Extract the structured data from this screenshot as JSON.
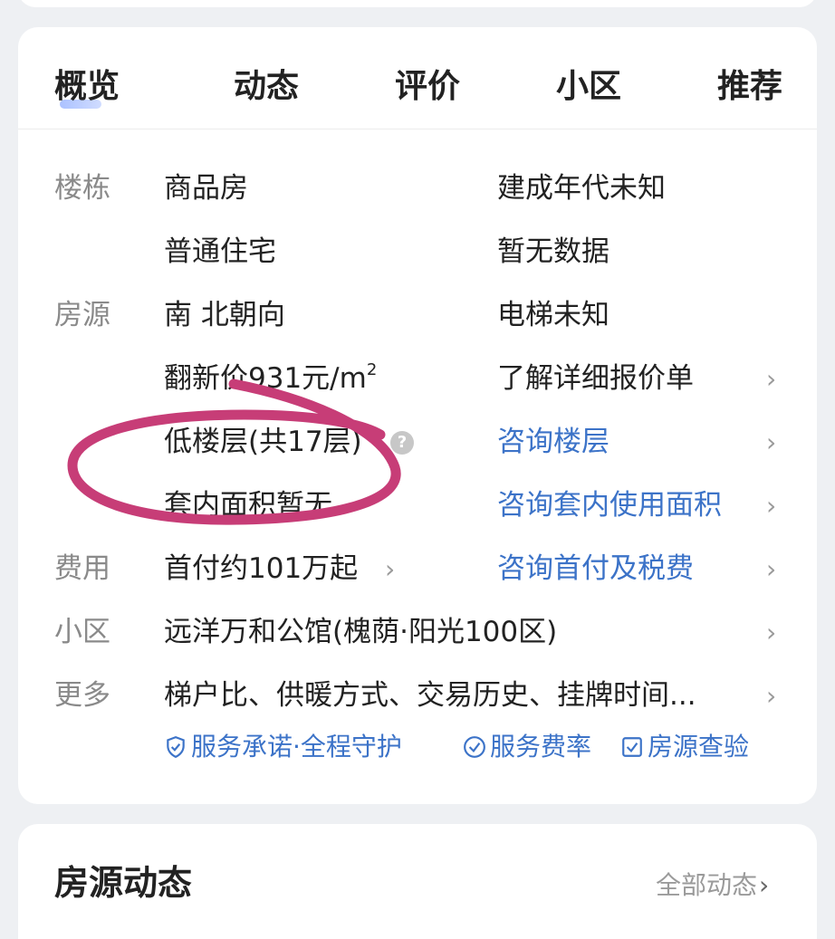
{
  "tabs": [
    {
      "label": "概览"
    },
    {
      "label": "动态"
    },
    {
      "label": "评价"
    },
    {
      "label": "小区"
    },
    {
      "label": "推荐"
    }
  ],
  "details": {
    "building_label": "楼栋",
    "building_type": "商品房",
    "build_year": "建成年代未知",
    "residence_type": "普通住宅",
    "no_data": "暂无数据",
    "listing_label": "房源",
    "orientation": "南 北朝向",
    "elevator": "电梯未知",
    "renovation_price": "翻新价931元/m",
    "renovation_sup": "2",
    "price_detail_link": "了解详细报价单",
    "floor_level": "低楼层(共17层)",
    "floor_help": "?",
    "consult_floor": "咨询楼层",
    "inner_area": "套内面积暂无",
    "consult_inner_area": "咨询套内使用面积",
    "fees_label": "费用",
    "down_payment": "首付约101万起",
    "consult_down_payment": "咨询首付及税费",
    "community_label": "小区",
    "community_name": "远洋万和公馆(槐荫·阳光100区)",
    "more_label": "更多",
    "more_items": "梯户比、供暖方式、交易历史、挂牌时间..."
  },
  "services": [
    {
      "label": "服务承诺·全程守护",
      "icon": "shield-icon"
    },
    {
      "label": "服务费率",
      "icon": "check-circle-icon"
    },
    {
      "label": "房源查验",
      "icon": "check-square-icon"
    }
  ],
  "bottom": {
    "title": "房源动态",
    "all_link": "全部动态"
  },
  "colors": {
    "accent_blue": "#3c73c8",
    "annotation_pink": "#c73d77"
  }
}
